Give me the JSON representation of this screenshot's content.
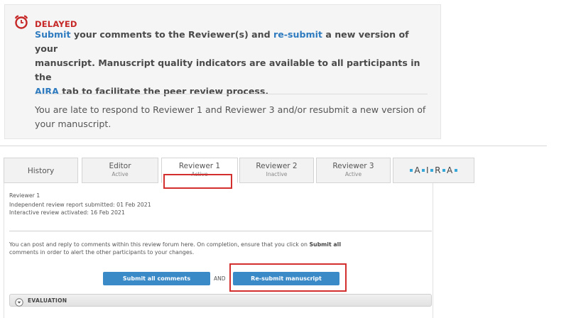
{
  "notice": {
    "status_label": "DELAYED",
    "line1": {
      "link1": "Submit",
      "t1": " your comments to the Reviewer(s) and ",
      "link2": "re-submit",
      "t2": " a new version of your"
    },
    "line2": "manuscript. Manuscript quality indicators are available to all participants in the",
    "line3": {
      "link": "AIRA",
      "text": " tab to facilitate the peer review process."
    },
    "late_line1": "You are late to respond to Reviewer 1 and Reviewer 3 and/or resubmit a new version of",
    "late_line2": "your manuscript."
  },
  "tabs": [
    {
      "name": "History",
      "status": ""
    },
    {
      "name": "Editor",
      "status": "Active"
    },
    {
      "name": "Reviewer 1",
      "status": "Active"
    },
    {
      "name": "Reviewer 2",
      "status": "Inactive"
    },
    {
      "name": "Reviewer 3",
      "status": "Active"
    },
    {
      "name": "A•I•R•A",
      "letters": [
        "A",
        "I",
        "R",
        "A"
      ]
    }
  ],
  "reviewer": {
    "title": "Reviewer 1",
    "submitted": "Independent review report submitted: 01 Feb 2021",
    "activated": "Interactive review activated: 16 Feb 2021"
  },
  "forum": {
    "instruction_pre": "You can post and reply to comments within this review forum here. On completion, ensure that you click on ",
    "instruction_bold": "Submit all",
    "instruction_line2": "comments in order to alert the other participants to your changes."
  },
  "buttons": {
    "submit_all": "Submit all comments",
    "and": "AND",
    "resubmit": "Re-submit manuscript"
  },
  "evaluation": {
    "label": "EVALUATION"
  },
  "colors": {
    "delayed": "#c62828",
    "link": "#2f7bbf",
    "button": "#3a8ac8",
    "highlight": "#d32f2f",
    "aira_dot": "#35a7d8"
  }
}
